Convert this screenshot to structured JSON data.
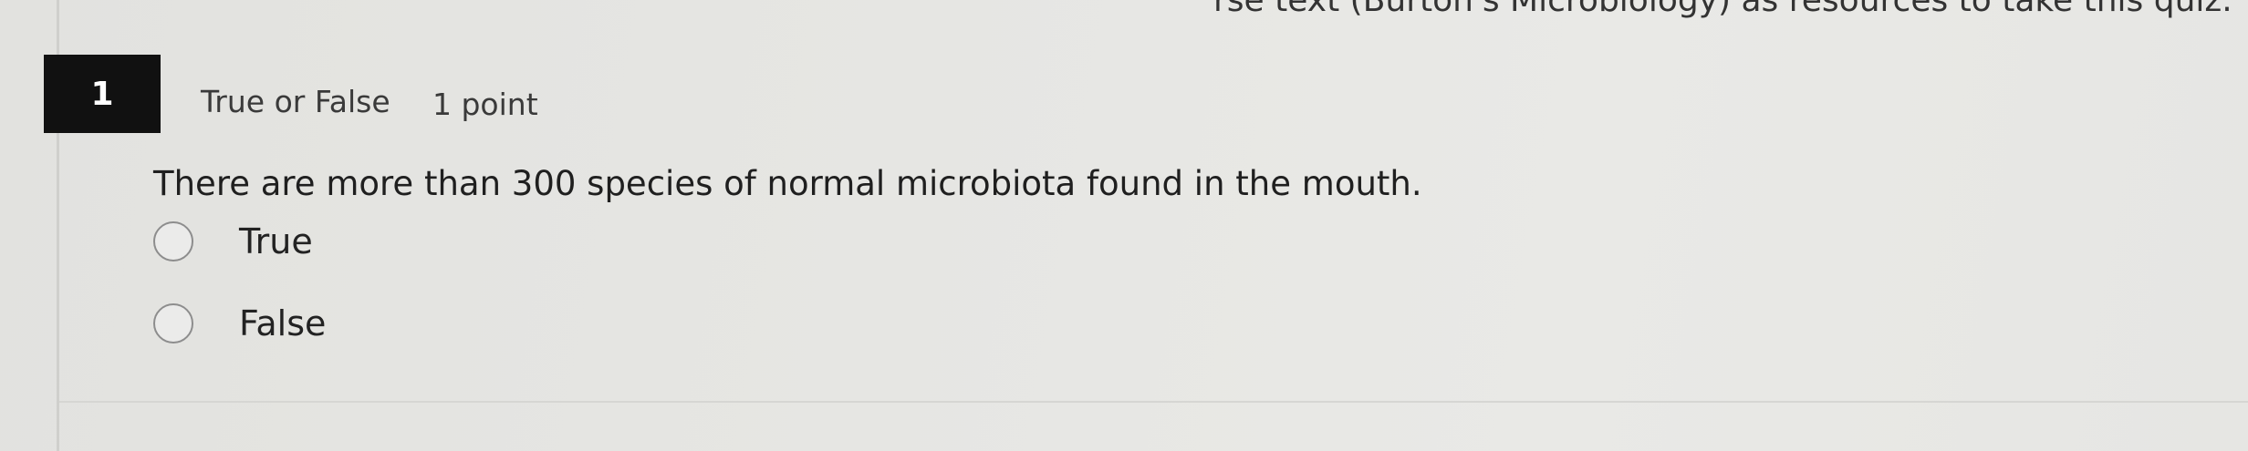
{
  "header": {
    "instruction_text": "rse text (Burton's Microbiology) as resources to take this quiz."
  },
  "question": {
    "number": "1",
    "type": "True or False",
    "points": "1 point",
    "text": "There are more than 300 species of normal microbiota found in the mouth.",
    "options": [
      {
        "label": "True",
        "selected": false
      },
      {
        "label": "False",
        "selected": false
      }
    ]
  }
}
